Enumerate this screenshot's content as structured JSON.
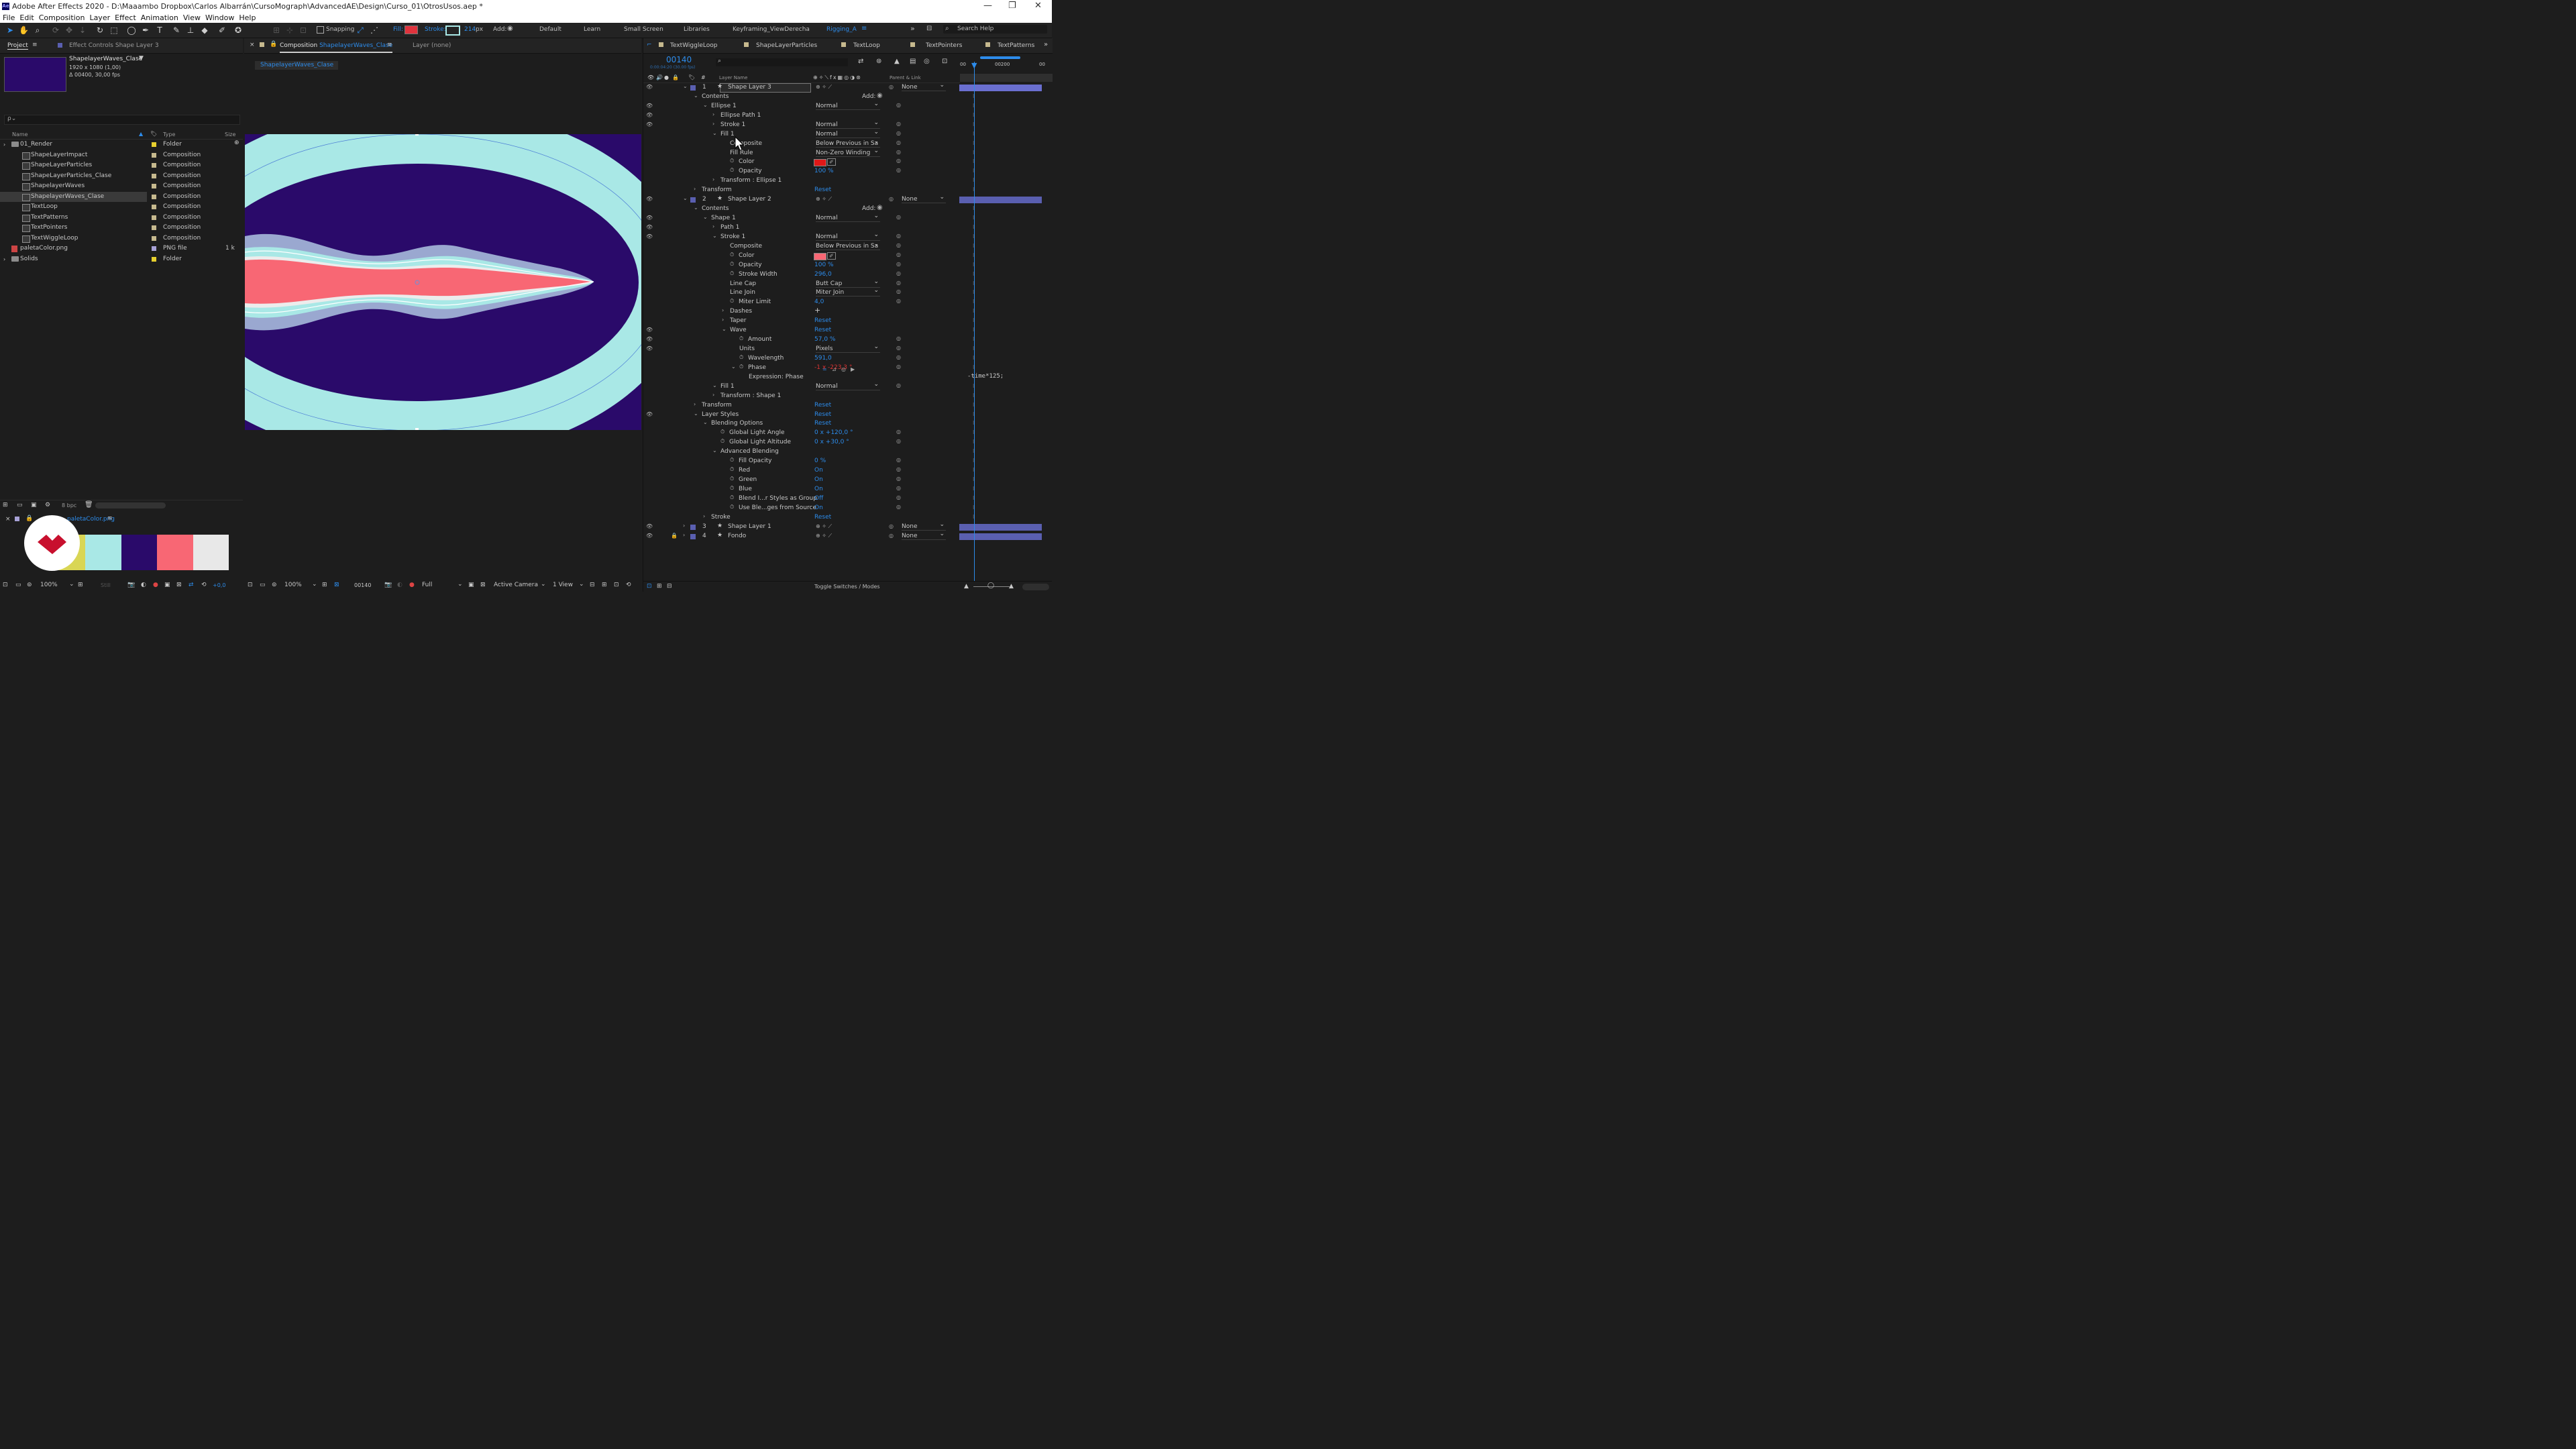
{
  "window": {
    "app_icon": "Ae",
    "title": "Adobe After Effects 2020 - D:\\Maaambo Dropbox\\Carlos Albarrán\\CursoMograph\\AdvancedAE\\Design\\Curso_01\\OtrosUsos.aep *",
    "minimize": "—",
    "maximize": "❐",
    "close": "✕"
  },
  "menu": [
    "File",
    "Edit",
    "Composition",
    "Layer",
    "Effect",
    "Animation",
    "View",
    "Window",
    "Help"
  ],
  "toolbar": {
    "snapping": "Snapping",
    "fill_label": "Fill:",
    "stroke_label": "Stroke:",
    "stroke_px": "214",
    "stroke_unit": "px",
    "add_label": "Add:",
    "workspaces": [
      "Default",
      "Learn",
      "Small Screen",
      "Libraries",
      "Keyframing_ViewDerecha",
      "Rigging_A"
    ],
    "search_placeholder": "Search Help",
    "fill_color": "#e0333d",
    "stroke_color": "#a9e8e6"
  },
  "project": {
    "tab_project": "Project",
    "tab_effect_controls": "Effect Controls",
    "effect_controls_layer": "Shape Layer 3",
    "preview": {
      "name": "ShapelayerWaves_Clase",
      "dims": "1920 x 1080 (1,00)",
      "duration": "Δ 00400, 30,00 fps",
      "thumb_color": "#2a0a6a"
    },
    "search_placeholder": "ρ⌄",
    "columns": {
      "name": "Name",
      "type": "Type",
      "size": "Size"
    },
    "items": [
      {
        "name": "01_Render",
        "type": "Folder",
        "icon": "folder",
        "label": "#e6cf2e",
        "indent": 0,
        "expand": "›",
        "size": ""
      },
      {
        "name": "ShapeLayerImpact",
        "type": "Composition",
        "icon": "composition",
        "label": "#c6b98e",
        "indent": 1,
        "expand": "",
        "size": ""
      },
      {
        "name": "ShapeLayerParticles",
        "type": "Composition",
        "icon": "composition",
        "label": "#c6b98e",
        "indent": 1,
        "expand": "",
        "size": ""
      },
      {
        "name": "ShapeLayerParticles_Clase",
        "type": "Composition",
        "icon": "composition",
        "label": "#c6b98e",
        "indent": 1,
        "expand": "",
        "size": ""
      },
      {
        "name": "ShapelayerWaves",
        "type": "Composition",
        "icon": "composition",
        "label": "#c6b98e",
        "indent": 1,
        "expand": "",
        "size": ""
      },
      {
        "name": "ShapelayerWaves_Clase",
        "type": "Composition",
        "icon": "composition",
        "label": "#c6b98e",
        "indent": 1,
        "expand": "",
        "size": "",
        "selected": true
      },
      {
        "name": "TextLoop",
        "type": "Composition",
        "icon": "composition",
        "label": "#c6b98e",
        "indent": 1,
        "expand": "",
        "size": ""
      },
      {
        "name": "TextPatterns",
        "type": "Composition",
        "icon": "composition",
        "label": "#c6b98e",
        "indent": 1,
        "expand": "",
        "size": ""
      },
      {
        "name": "TextPointers",
        "type": "Composition",
        "icon": "composition",
        "label": "#c6b98e",
        "indent": 1,
        "expand": "",
        "size": ""
      },
      {
        "name": "TextWiggleLoop",
        "type": "Composition",
        "icon": "composition",
        "label": "#c6b98e",
        "indent": 1,
        "expand": "",
        "size": ""
      },
      {
        "name": "paletaColor.png",
        "type": "PNG file",
        "icon": "png",
        "label": "#a7a1d6",
        "indent": 0,
        "expand": "",
        "size": "1 k"
      },
      {
        "name": "Solids",
        "type": "Folder",
        "icon": "folder",
        "label": "#e6cf2e",
        "indent": 0,
        "expand": "›",
        "size": ""
      }
    ],
    "bpc": "8 bpc"
  },
  "footage_viewer": {
    "tab": "paletaColor.png",
    "swatches": [
      "#d9d655",
      "#a9e8e6",
      "#2a0a6a",
      "#f86774",
      "#e8e8e8"
    ],
    "zoom": "100%",
    "still": "Still",
    "exposure": "+0,0"
  },
  "composition_viewer": {
    "tab_prefix": "Composition",
    "comp_name": "ShapelayerWaves_Clase",
    "layer_tab": "Layer  (none)",
    "breadcrumb": "ShapelayerWaves_Clase",
    "zoom": "100%",
    "timecode": "00140",
    "resolution": "Full",
    "camera": "Active Camera",
    "views": "1 View",
    "exposure": "+0,0",
    "colors": {
      "bg": "#2a0a6a",
      "cyan": "#a9e8e6",
      "pink": "#f86774",
      "white": "#ececec",
      "lilac": "#9aa8d0"
    }
  },
  "timeline": {
    "tabs": [
      "TextWiggleLoop",
      "ShapeLayerParticles",
      "TextLoop",
      "TextPointers",
      "TextPatterns"
    ],
    "timecode": "00140",
    "timecode_sub": "0:00:04:20 (30.00 fps)",
    "ruler": [
      "00",
      "00200",
      "00"
    ],
    "header": {
      "layer_name": "Layer Name",
      "parent": "Parent & Link"
    },
    "toggle_label": "Toggle Switches / Modes",
    "add_label": "Add:",
    "expression_text": "-time*125;",
    "rows": [
      {
        "kind": "layer",
        "num": "1",
        "name": "Shape Layer 3",
        "parent": "None",
        "selected": true
      },
      {
        "kind": "prop",
        "name": "Contents",
        "indent": 1,
        "value": ""
      },
      {
        "kind": "prop",
        "name": "Ellipse 1",
        "indent": 2,
        "value": "Normal",
        "dd": true
      },
      {
        "kind": "prop",
        "name": "Ellipse Path 1",
        "indent": 3,
        "value": ""
      },
      {
        "kind": "prop",
        "name": "Stroke 1",
        "indent": 3,
        "value": "Normal",
        "dd": true
      },
      {
        "kind": "prop",
        "name": "Fill 1",
        "indent": 3,
        "value": "Normal",
        "dd": true
      },
      {
        "kind": "prop",
        "name": "Composite",
        "indent": 4,
        "value": "Below Previous in Sa",
        "dd": true
      },
      {
        "kind": "prop",
        "name": "Fill Rule",
        "indent": 4,
        "value": "Non-Zero Winding",
        "dd": true
      },
      {
        "kind": "prop",
        "name": "Color",
        "indent": 4,
        "value": "",
        "color": "#e01818"
      },
      {
        "kind": "prop",
        "name": "Opacity",
        "indent": 4,
        "value": "100 %",
        "blue": true
      },
      {
        "kind": "prop",
        "name": "Transform : Ellipse 1",
        "indent": 3,
        "value": ""
      },
      {
        "kind": "prop",
        "name": "Transform",
        "indent": 1,
        "value": "Reset",
        "blue": true
      },
      {
        "kind": "layer",
        "num": "2",
        "name": "Shape Layer 2",
        "parent": "None"
      },
      {
        "kind": "prop",
        "name": "Contents",
        "indent": 1,
        "value": ""
      },
      {
        "kind": "prop",
        "name": "Shape 1",
        "indent": 2,
        "value": "Normal",
        "dd": true
      },
      {
        "kind": "prop",
        "name": "Path 1",
        "indent": 3,
        "value": ""
      },
      {
        "kind": "prop",
        "name": "Stroke 1",
        "indent": 3,
        "value": "Normal",
        "dd": true
      },
      {
        "kind": "prop",
        "name": "Composite",
        "indent": 4,
        "value": "Below Previous in Sa",
        "dd": true
      },
      {
        "kind": "prop",
        "name": "Color",
        "indent": 4,
        "value": "",
        "color": "#f86774"
      },
      {
        "kind": "prop",
        "name": "Opacity",
        "indent": 4,
        "value": "100 %",
        "blue": true
      },
      {
        "kind": "prop",
        "name": "Stroke Width",
        "indent": 4,
        "value": "296,0",
        "blue": true
      },
      {
        "kind": "prop",
        "name": "Line Cap",
        "indent": 4,
        "value": "Butt Cap",
        "dd": true
      },
      {
        "kind": "prop",
        "name": "Line Join",
        "indent": 4,
        "value": "Miter Join",
        "dd": true
      },
      {
        "kind": "prop",
        "name": "Miter Limit",
        "indent": 4,
        "value": "4,0",
        "blue": true
      },
      {
        "kind": "prop",
        "name": "Dashes",
        "indent": 4,
        "value": "+"
      },
      {
        "kind": "prop",
        "name": "Taper",
        "indent": 4,
        "value": "Reset",
        "blue": true
      },
      {
        "kind": "prop",
        "name": "Wave",
        "indent": 4,
        "value": "Reset",
        "blue": true
      },
      {
        "kind": "prop",
        "name": "Amount",
        "indent": 5,
        "value": "57,0 %",
        "blue": true
      },
      {
        "kind": "prop",
        "name": "Units",
        "indent": 5,
        "value": "Pixels",
        "dd": true
      },
      {
        "kind": "prop",
        "name": "Wavelength",
        "indent": 5,
        "value": "591,0",
        "blue": true
      },
      {
        "kind": "prop",
        "name": "Phase",
        "indent": 5,
        "value": "-1 x -223,3 °",
        "red": true
      },
      {
        "kind": "prop",
        "name": "Expression: Phase",
        "indent": 6,
        "value": ""
      },
      {
        "kind": "prop",
        "name": "Fill 1",
        "indent": 3,
        "value": "Normal",
        "dd": true
      },
      {
        "kind": "prop",
        "name": "Transform : Shape 1",
        "indent": 3,
        "value": ""
      },
      {
        "kind": "prop",
        "name": "Transform",
        "indent": 1,
        "value": "Reset",
        "blue": true
      },
      {
        "kind": "prop",
        "name": "Layer Styles",
        "indent": 1,
        "value": "Reset",
        "blue": true
      },
      {
        "kind": "prop",
        "name": "Blending Options",
        "indent": 2,
        "value": "Reset",
        "blue": true
      },
      {
        "kind": "prop",
        "name": "Global Light Angle",
        "indent": 3,
        "value": "0 x +120,0 °",
        "blue": true
      },
      {
        "kind": "prop",
        "name": "Global Light Altitude",
        "indent": 3,
        "value": "0 x +30,0 °",
        "blue": true
      },
      {
        "kind": "prop",
        "name": "Advanced Blending",
        "indent": 3,
        "value": ""
      },
      {
        "kind": "prop",
        "name": "Fill Opacity",
        "indent": 4,
        "value": "0 %",
        "blue": true
      },
      {
        "kind": "prop",
        "name": "Red",
        "indent": 4,
        "value": "On",
        "blue": true
      },
      {
        "kind": "prop",
        "name": "Green",
        "indent": 4,
        "value": "On",
        "blue": true
      },
      {
        "kind": "prop",
        "name": "Blue",
        "indent": 4,
        "value": "On",
        "blue": true
      },
      {
        "kind": "prop",
        "name": "Blend I...r Styles as Group",
        "indent": 4,
        "value": "Off",
        "blue": true
      },
      {
        "kind": "prop",
        "name": "Use Ble...ges from Source",
        "indent": 4,
        "value": "On",
        "blue": true
      },
      {
        "kind": "prop",
        "name": "Stroke",
        "indent": 2,
        "value": "Reset",
        "blue": true
      },
      {
        "kind": "layer",
        "num": "3",
        "name": "Shape Layer 1",
        "parent": "None"
      },
      {
        "kind": "layer",
        "num": "4",
        "name": "Fondo",
        "parent": "None",
        "locked": true
      }
    ]
  },
  "brand_logo": "logo"
}
